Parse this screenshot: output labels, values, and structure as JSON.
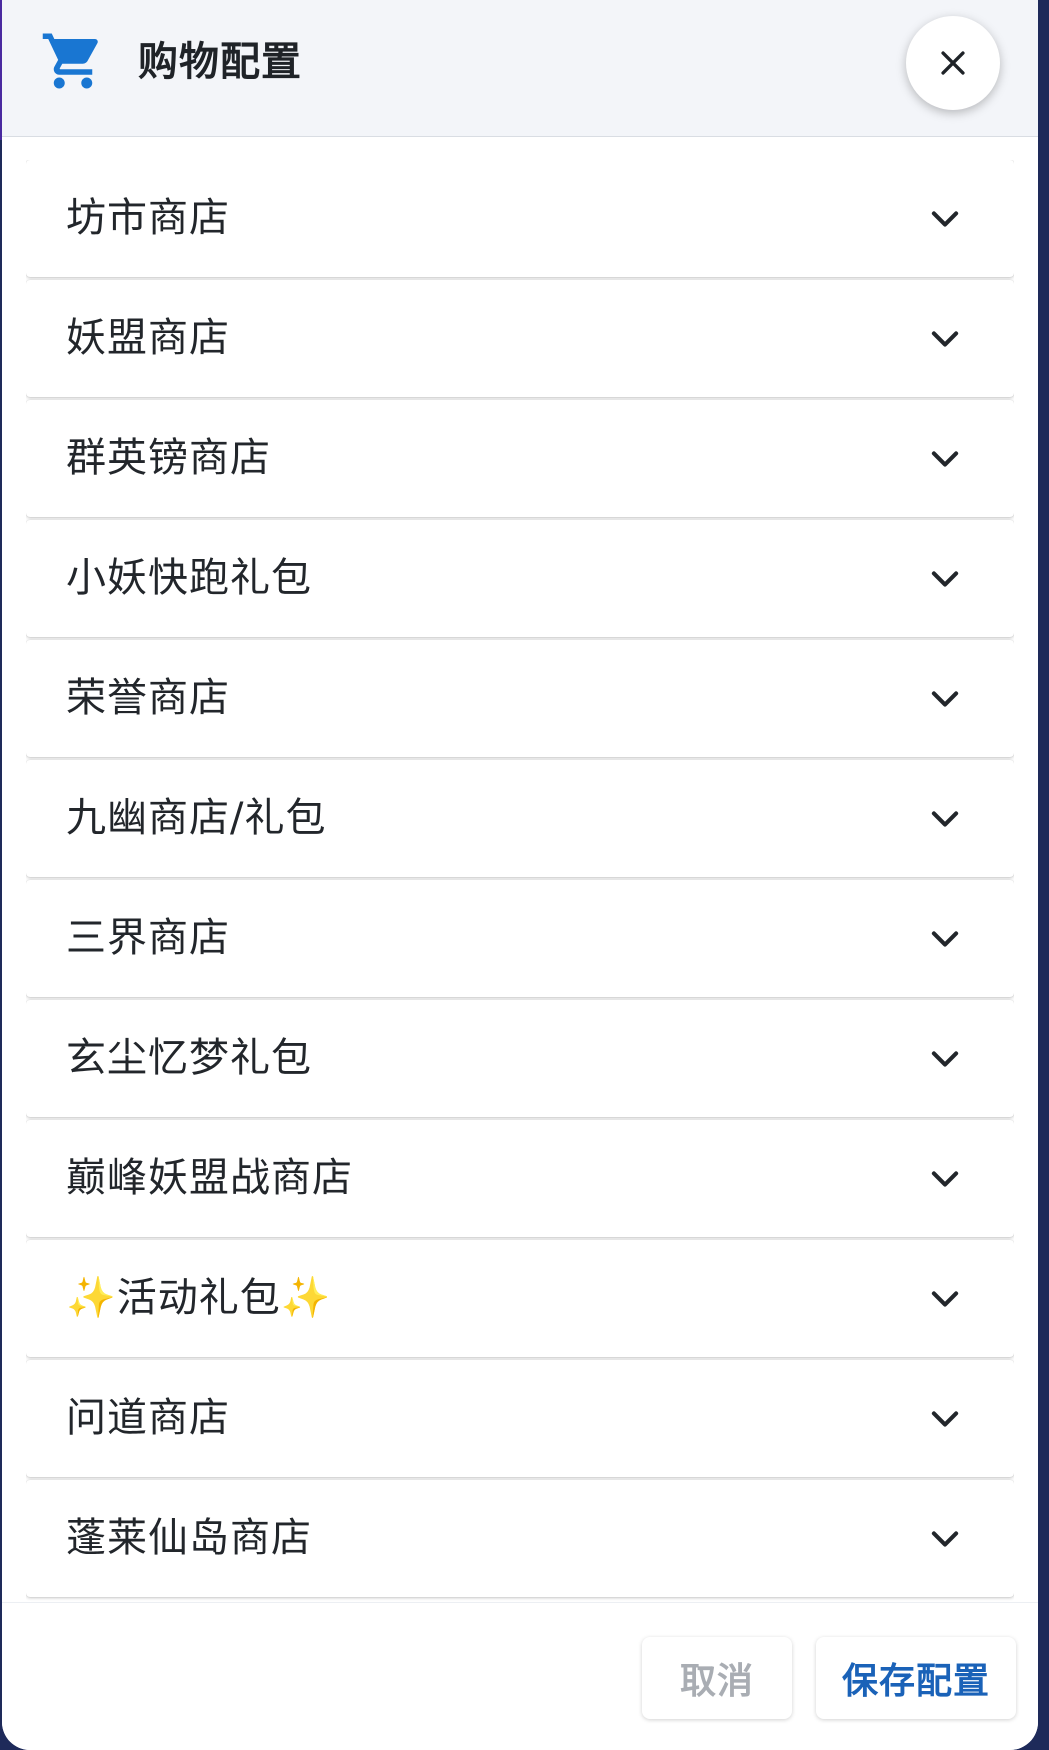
{
  "dialog": {
    "title": "购物配置",
    "icon": "shopping-cart-icon",
    "close_icon": "close-icon"
  },
  "panels": [
    {
      "label": "坊市商店"
    },
    {
      "label": "妖盟商店"
    },
    {
      "label": "群英镑商店"
    },
    {
      "label": "小妖快跑礼包"
    },
    {
      "label": "荣誉商店"
    },
    {
      "label": "九幽商店/礼包"
    },
    {
      "label": "三界商店"
    },
    {
      "label": "玄尘忆梦礼包"
    },
    {
      "label": "巅峰妖盟战商店"
    },
    {
      "label": "✨活动礼包✨"
    },
    {
      "label": "问道商店"
    },
    {
      "label": "蓬莱仙岛商店"
    }
  ],
  "footer": {
    "cancel_label": "取消",
    "save_label": "保存配置"
  },
  "colors": {
    "accent": "#1a62b8",
    "icon_blue": "#1976d2",
    "header_bg": "#f3f5f9",
    "disabled_text": "#a9adb3"
  }
}
